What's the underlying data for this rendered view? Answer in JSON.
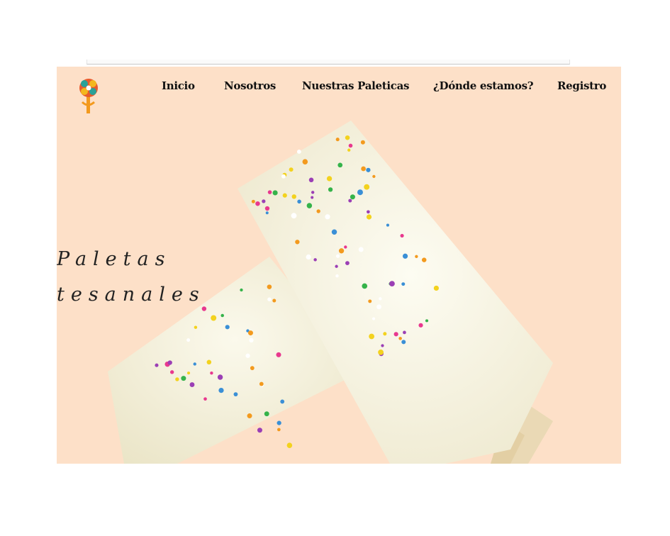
{
  "nav": {
    "items": [
      {
        "label": "Inicio"
      },
      {
        "label": "Nosotros"
      },
      {
        "label": "Nuestras Paleticas"
      },
      {
        "label": "¿Dónde estamos?"
      },
      {
        "label": "Registro"
      }
    ]
  },
  "hero": {
    "tagline_line1": "Paletas",
    "tagline_line2": "tesanales"
  },
  "icons": {
    "logo": "lollipop-flower-icon"
  },
  "colors": {
    "hero_background": "#fde0c8",
    "popsicle_cream": "#f6f3df",
    "stick": "#ead9b5",
    "nav_text": "#111111"
  }
}
